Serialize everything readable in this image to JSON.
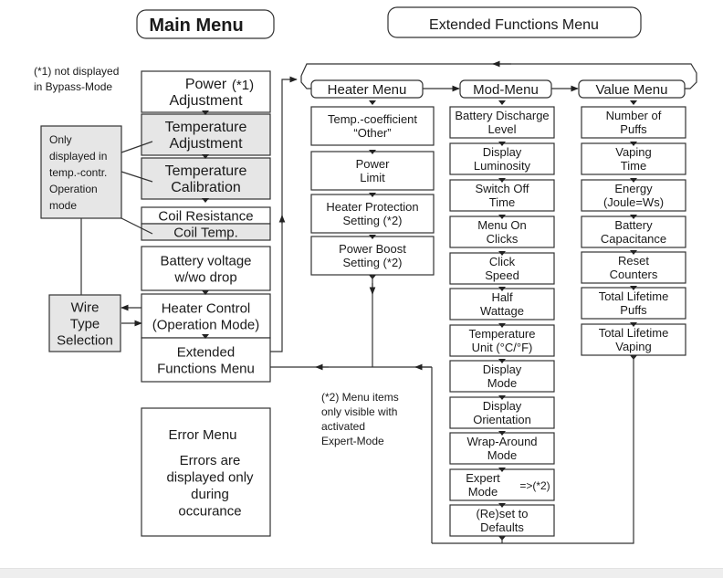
{
  "title_main": "Main Menu",
  "title_extended": "Extended Functions Menu",
  "colors": {
    "shaded_box": "#e6e6e6",
    "line": "#333333",
    "text": "#1a1a1a"
  },
  "notes": {
    "bypass": [
      "(*1) not displayed",
      "in Bypass-Mode"
    ],
    "temp_only": [
      "Only",
      "displayed in",
      "temp.-contr.",
      "Operation",
      "mode"
    ],
    "expert": [
      "(*2) Menu items",
      "only visible with",
      "activated",
      "Expert-Mode"
    ]
  },
  "main_menu": [
    {
      "lines": [
        "Power",
        "Adjustment"
      ],
      "suffix": "(*1)",
      "shaded": false
    },
    {
      "lines": [
        "Temperature",
        "Adjustment"
      ],
      "shaded": true
    },
    {
      "lines": [
        "Temperature",
        "Calibration"
      ],
      "shaded": true
    },
    {
      "lines": [
        "Coil Resistance"
      ],
      "shaded": false
    },
    {
      "lines": [
        "Coil Temp."
      ],
      "shaded": true
    },
    {
      "lines": [
        "Battery voltage",
        "w/wo drop"
      ],
      "shaded": false
    },
    {
      "lines": [
        "Heater Control",
        "(Operation Mode)"
      ],
      "shaded": false
    },
    {
      "lines": [
        "Extended",
        "Functions Menu"
      ],
      "shaded": false
    }
  ],
  "wire_type": [
    "Wire",
    "Type",
    "Selection"
  ],
  "error_menu": {
    "title": "Error Menu",
    "lines": [
      "Errors are",
      "displayed only",
      "during",
      "occurance"
    ]
  },
  "submenus": [
    {
      "title": "Heater Menu",
      "items": [
        [
          "Temp.-coefficient",
          "“Other”"
        ],
        [
          "Power",
          "Limit"
        ],
        [
          "Heater Protection",
          "Setting (*2)"
        ],
        [
          "Power Boost",
          "Setting (*2)"
        ]
      ]
    },
    {
      "title": "Mod-Menu",
      "items": [
        [
          "Battery Discharge",
          "Level"
        ],
        [
          "Display",
          "Luminosity"
        ],
        [
          "Switch Off",
          "Time"
        ],
        [
          "Menu On",
          "Clicks"
        ],
        [
          "Click",
          "Speed"
        ],
        [
          "Half",
          "Wattage"
        ],
        [
          "Temperature",
          "Unit (°C/°F)"
        ],
        [
          "Display",
          "Mode"
        ],
        [
          "Display",
          "Orientation"
        ],
        [
          "Wrap-Around",
          "Mode"
        ],
        [
          "Expert",
          "Mode"
        ],
        [
          "(Re)set to",
          "Defaults"
        ]
      ],
      "expert_suffix": "=>(*2)"
    },
    {
      "title": "Value Menu",
      "items": [
        [
          "Number of",
          "Puffs"
        ],
        [
          "Vaping",
          "Time"
        ],
        [
          "Energy",
          "(Joule=Ws)"
        ],
        [
          "Battery",
          "Capacitance"
        ],
        [
          "Reset",
          "Counters"
        ],
        [
          "Total Lifetime",
          "Puffs"
        ],
        [
          "Total Lifetime",
          "Vaping"
        ]
      ]
    }
  ]
}
